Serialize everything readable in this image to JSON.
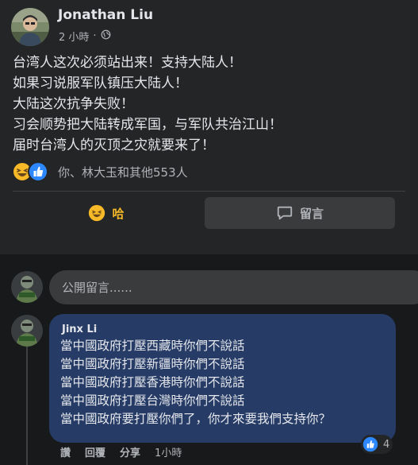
{
  "post": {
    "author": "Jonathan Liu",
    "time": "2 小時",
    "privacy_icon": "globe-icon",
    "lines": [
      "台湾人这次必须站出来！支持大陆人！",
      "如果习说服军队镇压大陆人！",
      "大陆这次抗争失败！",
      "习会顺势把大陆转成军国，与军队共治江山！",
      "届时台湾人的灭顶之灾就要来了！"
    ],
    "reaction_icons": [
      "haha-icon",
      "like-icon"
    ],
    "reactions_text": "你、林大玉和其他553人",
    "action_haha": "哈",
    "action_comment": "留言"
  },
  "compose": {
    "placeholder": "公開留言......"
  },
  "comment": {
    "author": "Jinx Li",
    "lines": [
      "當中國政府打壓西藏時你們不說話",
      "當中國政府打壓新疆時你們不說話",
      "當中國政府打壓香港時你們不說話",
      "當中國政府打壓台灣時你們不說話",
      "當中國政府要打壓你們了，你才來要我們支持你？"
    ],
    "like_count": "4",
    "actions": {
      "like": "讚",
      "reply": "回覆",
      "share": "分享",
      "time": "1小時"
    }
  },
  "colors": {
    "background": "#18191a",
    "card": "#242526",
    "bubble": "#263c66",
    "haha_accent": "#f7b928",
    "like_blue": "#2d88ff"
  }
}
